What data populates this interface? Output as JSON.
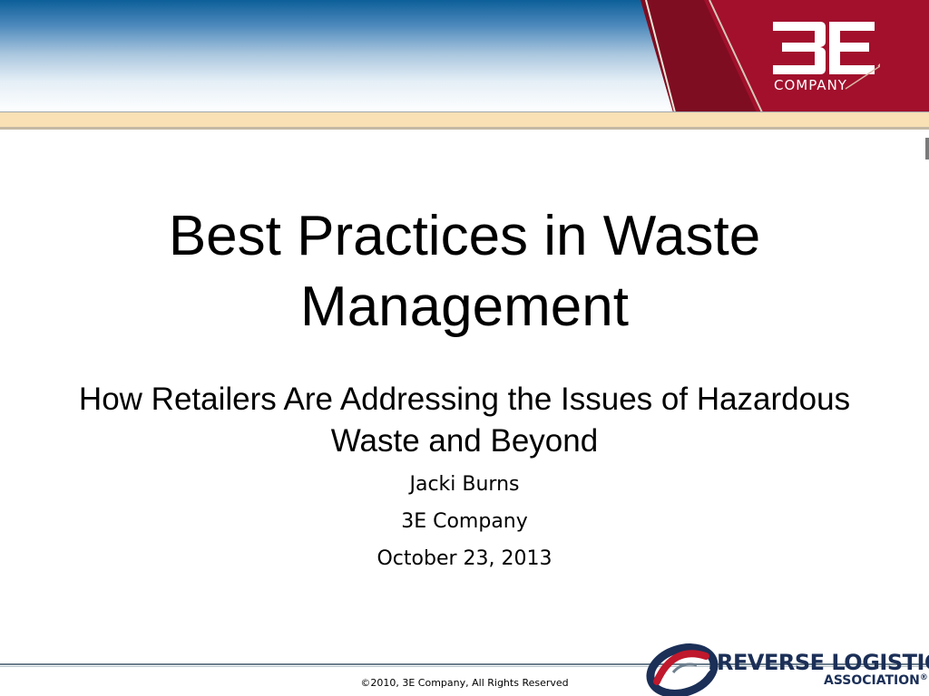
{
  "slide": {
    "title": "Best Practices in Waste Management",
    "subtitle": "How Retailers Are Addressing the Issues of Hazardous Waste and Beyond",
    "author": "Jacki Burns",
    "company": "3E Company",
    "date": "October 23, 2013"
  },
  "header": {
    "logo_text": "3E",
    "logo_subtext": "COMPANY"
  },
  "footer": {
    "copyright": "©2010, 3E Company, All Rights Reserved",
    "rla_name": "REVERSE LOGISTICS",
    "rla_sub": "ASSOCIATION",
    "rla_mark": "®"
  },
  "colors": {
    "header_blue": "#0d5f99",
    "header_red": "#a2102c",
    "band_tan": "#f9e0b5",
    "rla_navy": "#1b2f57",
    "rla_red": "#c0182c"
  },
  "icons": [
    "3e-company-logo",
    "rla-swirl-logo",
    "arrow-tick-decoration"
  ]
}
